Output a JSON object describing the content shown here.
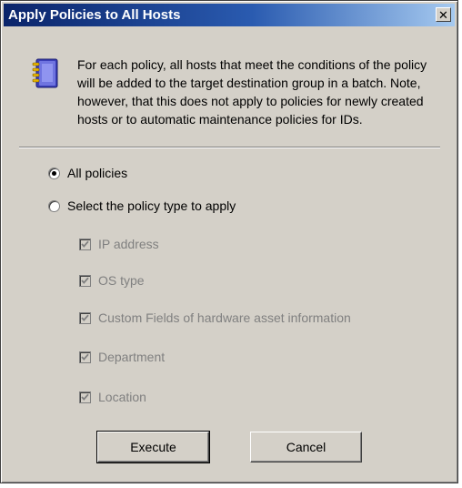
{
  "dialog": {
    "title": "Apply Policies to All Hosts",
    "close_label": "✕",
    "info_icon": "notebook-icon",
    "info_text": "For each policy, all hosts that meet the conditions of the policy will be added to the target destination group in a batch. Note, however, that this does not apply to policies for newly created hosts or to automatic maintenance policies for IDs."
  },
  "options": {
    "all_policies": {
      "label": "All policies",
      "selected": true
    },
    "select_type": {
      "label": "Select the policy type to apply",
      "selected": false
    }
  },
  "policy_types": [
    {
      "label": "IP address",
      "checked": true,
      "enabled": false
    },
    {
      "label": "OS type",
      "checked": true,
      "enabled": false
    },
    {
      "label": "Custom Fields of hardware asset information",
      "checked": true,
      "enabled": false
    },
    {
      "label": "Department",
      "checked": true,
      "enabled": false
    },
    {
      "label": "Location",
      "checked": true,
      "enabled": false
    }
  ],
  "buttons": {
    "execute": "Execute",
    "cancel": "Cancel"
  },
  "colors": {
    "title_start": "#0a246a",
    "title_end": "#a6caf0",
    "face": "#d4d0c8",
    "disabled_text": "#808080"
  }
}
